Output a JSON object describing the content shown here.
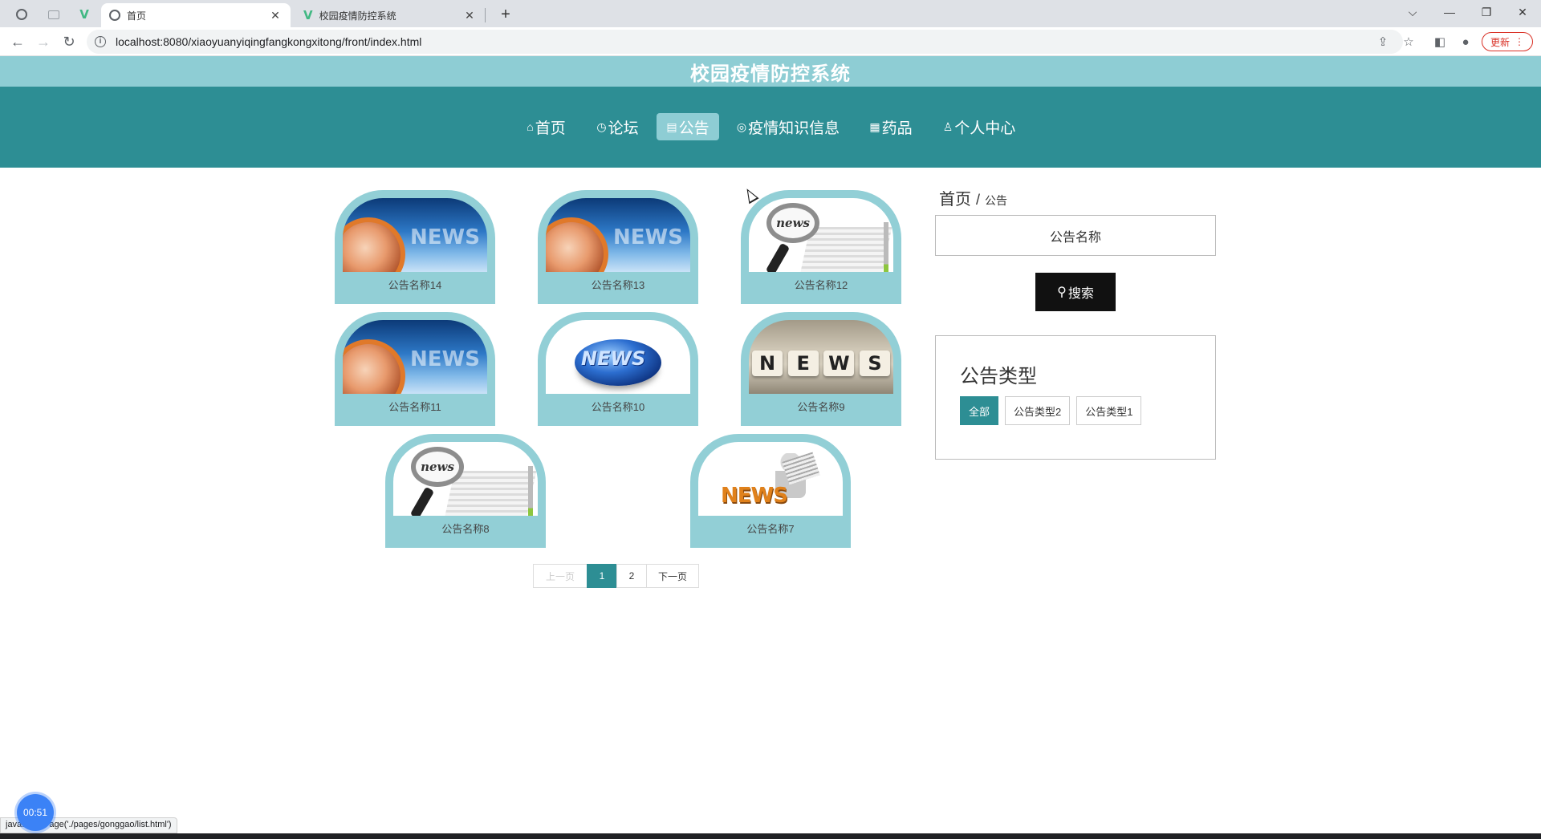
{
  "browser": {
    "tabs": [
      {
        "title": "首页",
        "active": true
      },
      {
        "title": "校园疫情防控系统",
        "active": false
      }
    ],
    "new_tab_symbol": "+",
    "url": "localhost:8080/xiaoyuanyiqingfangkongxitong/front/index.html",
    "update_label": "更新",
    "window_controls": {
      "collapse": "⌵",
      "minimize": "—",
      "restore": "❐",
      "close": "✕"
    }
  },
  "site": {
    "title": "校园疫情防控系统"
  },
  "nav": {
    "items": [
      {
        "icon": "⌂",
        "label": "首页",
        "active": false
      },
      {
        "icon": "◷",
        "label": "论坛",
        "active": false
      },
      {
        "icon": "▤",
        "label": "公告",
        "active": true
      },
      {
        "icon": "◎",
        "label": "疫情知识信息",
        "active": false
      },
      {
        "icon": "▦",
        "label": "药品",
        "active": false
      },
      {
        "icon": "♙",
        "label": "个人中心",
        "active": false
      }
    ]
  },
  "cards": [
    {
      "title": "公告名称14",
      "image": "globe-news-image",
      "image_text": "NEWS"
    },
    {
      "title": "公告名称13",
      "image": "globe-news-image",
      "image_text": "NEWS"
    },
    {
      "title": "公告名称12",
      "image": "magnifier-newspaper-image",
      "image_text": "news"
    },
    {
      "title": "公告名称11",
      "image": "globe-news-image",
      "image_text": "NEWS"
    },
    {
      "title": "公告名称10",
      "image": "earth-news-image",
      "image_text": "NEWS"
    },
    {
      "title": "公告名称9",
      "image": "dice-news-image",
      "image_text": "NEWS"
    },
    {
      "title": "公告名称8",
      "image": "magnifier-newspaper-image",
      "image_text": "news"
    },
    {
      "title": "公告名称7",
      "image": "reader-news-image",
      "image_text": "NEWS"
    }
  ],
  "pagination": {
    "prev": "上一页",
    "pages": [
      "1",
      "2"
    ],
    "current": "1",
    "next": "下一页"
  },
  "sidebar": {
    "breadcrumb": {
      "home": "首页",
      "separator": "/",
      "current": "公告"
    },
    "search": {
      "placeholder": "公告名称",
      "button": "搜索"
    },
    "types": {
      "title": "公告类型",
      "items": [
        {
          "label": "全部",
          "active": true
        },
        {
          "label": "公告类型2",
          "active": false
        },
        {
          "label": "公告类型1",
          "active": false
        }
      ]
    }
  },
  "status_bar": "java...navPage('./pages/gonggao/list.html')",
  "timer": "00:51",
  "colors": {
    "title_bar": "#8ecdd4",
    "navbar": "#2d8e94",
    "card": "#92cfd6",
    "accent": "#2d8e94",
    "search_button": "#111111"
  }
}
